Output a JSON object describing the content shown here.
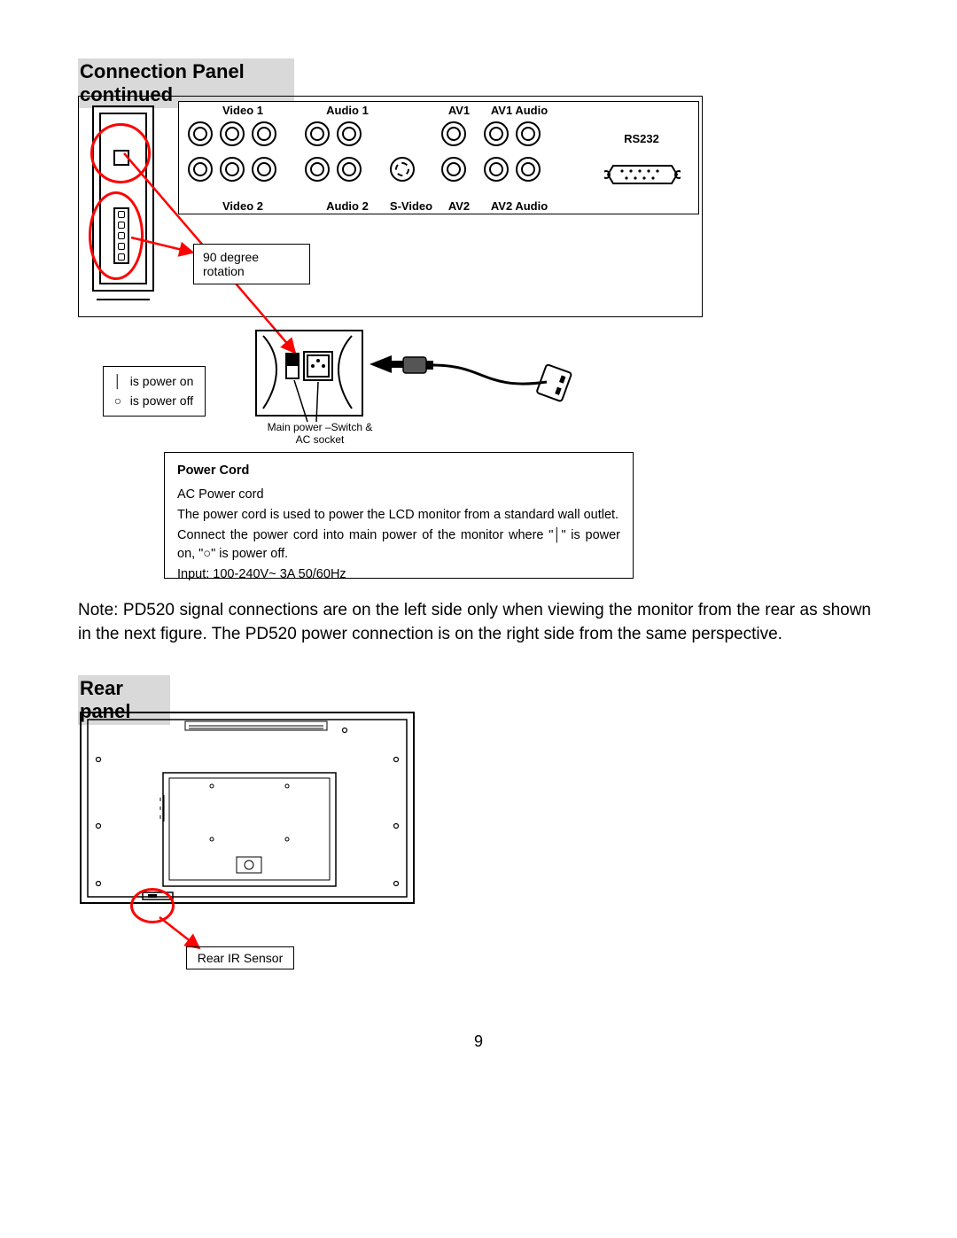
{
  "headings": {
    "section1": "Connection Panel continued",
    "section2": "Rear panel"
  },
  "panel_labels": {
    "top": {
      "video1": "Video 1",
      "audio1": "Audio 1",
      "av1": "AV1",
      "av1_audio": "AV1 Audio"
    },
    "bottom": {
      "video2": "Video 2",
      "audio2": "Audio 2",
      "svideo": "S-Video",
      "av2": "AV2",
      "av2_audio": "AV2 Audio"
    },
    "rs232": "RS232"
  },
  "callouts": {
    "rotation": "90 degree rotation",
    "power_on": "is power on",
    "power_off": "is power off",
    "ac_caption_line1": "Main power –Switch &",
    "ac_caption_line2": "AC socket",
    "rear_ir": "Rear IR Sensor"
  },
  "symbols": {
    "on": "│",
    "off": "○"
  },
  "power_cord": {
    "title": "Power Cord",
    "line1": "AC Power cord",
    "line2": "The power cord is used to power the LCD monitor from a standard wall outlet.",
    "line3a": "Connect the power cord into main power of the monitor where   \"",
    "line3b": "\" is power on, \"",
    "line3c": "\" is power off.",
    "line4": "Input: 100-240V~ 3A 50/60Hz"
  },
  "note": "Note: PD520 signal connections are on the left side only when viewing the monitor from the rear as shown in the next figure. The PD520 power connection is on the right side from the same perspective.",
  "page_number": "9"
}
